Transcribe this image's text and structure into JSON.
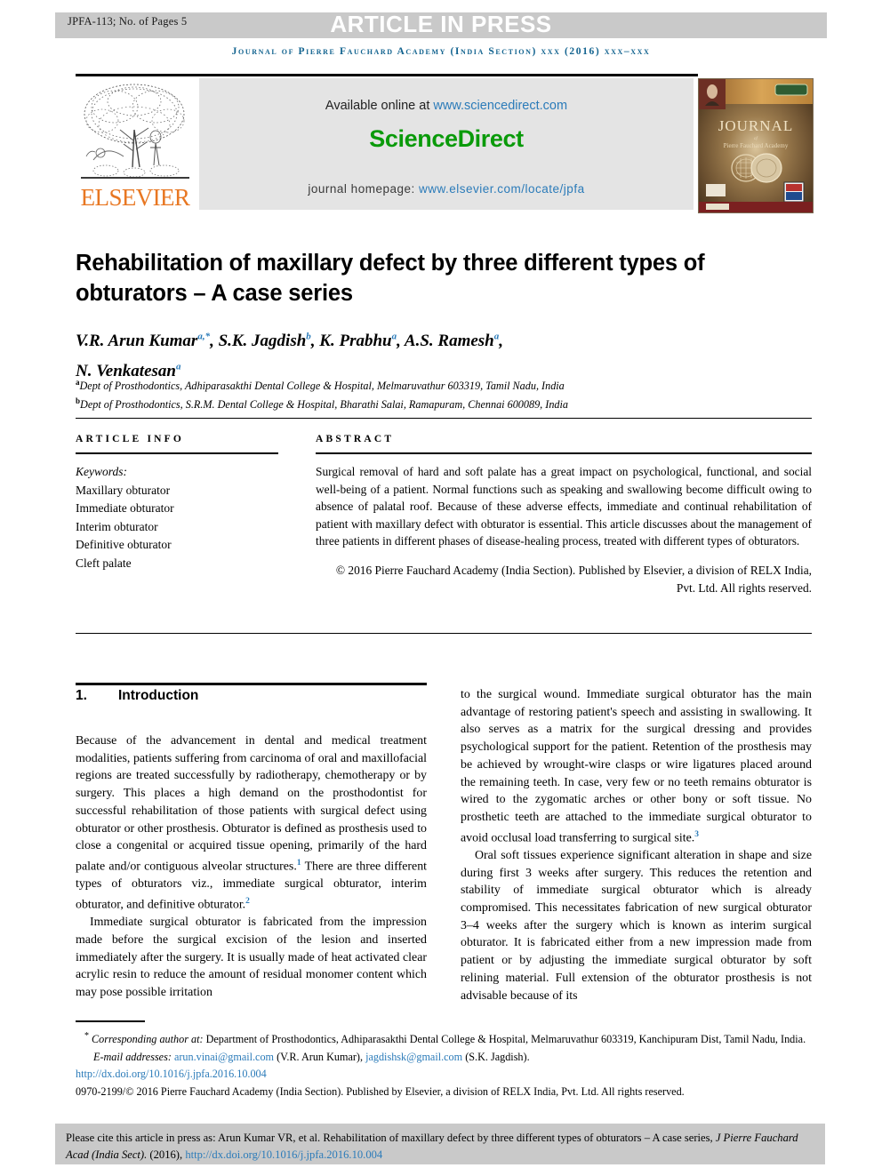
{
  "header": {
    "jpfa_label": "JPFA-113; No. of Pages 5",
    "article_in_press": "ARTICLE IN PRESS",
    "journal_line": "Journal of Pierre Fauchard Academy (India Section) xxx (2016) xxx–xxx"
  },
  "masthead": {
    "elsevier_wordmark": "ELSEVIER",
    "available_online_prefix": "Available online at ",
    "sciencedirect_url": "www.sciencedirect.com",
    "sciencedirect_logo": "ScienceDirect",
    "homepage_prefix": "journal homepage: ",
    "homepage_url": "www.elsevier.com/locate/jpfa",
    "cover_title": "JOURNAL",
    "cover_subtitle": "Pierre Fauchard Academy"
  },
  "article": {
    "title": "Rehabilitation of maxillary defect by three different types of obturators – A case series",
    "affiliation_a": "Dept of Prosthodontics, Adhiparasakthi Dental College & Hospital, Melmaruvathur 603319, Tamil Nadu, India",
    "affiliation_b": "Dept of Prosthodontics, S.R.M. Dental College & Hospital, Bharathi Salai, Ramapuram, Chennai 600089, India",
    "authors": [
      {
        "name": "V.R. Arun Kumar",
        "marks": "a,*"
      },
      {
        "name": "S.K. Jagdish",
        "marks": "b"
      },
      {
        "name": "K. Prabhu",
        "marks": "a"
      },
      {
        "name": "A.S. Ramesh",
        "marks": "a"
      },
      {
        "name": "N. Venkatesan",
        "marks": "a"
      }
    ]
  },
  "article_info": {
    "heading": "ARTICLE INFO",
    "keywords_label": "Keywords:",
    "keywords": [
      "Maxillary obturator",
      "Immediate obturator",
      "Interim obturator",
      "Definitive obturator",
      "Cleft palate"
    ]
  },
  "abstract": {
    "heading": "ABSTRACT",
    "text": "Surgical removal of hard and soft palate has a great impact on psychological, functional, and social well-being of a patient. Normal functions such as speaking and swallowing become difficult owing to absence of palatal roof. Because of these adverse effects, immediate and continual rehabilitation of patient with maxillary defect with obturator is essential. This article discusses about the management of three patients in different phases of disease-healing process, treated with different types of obturators.",
    "copyright": "© 2016 Pierre Fauchard Academy (India Section). Published by Elsevier, a division of RELX India, Pvt. Ltd. All rights reserved."
  },
  "body": {
    "section_number": "1.",
    "section_title": "Introduction",
    "left_paragraphs": [
      {
        "indent": false,
        "parts": [
          {
            "t": "Because of the advancement in dental and medical treatment modalities, patients suffering from carcinoma of oral and maxillofacial regions are treated successfully by radiotherapy, chemotherapy or by surgery. This places a high demand on the prosthodontist for successful rehabilitation of those patients with surgical defect using obturator or other prosthesis. Obturator is defined as prosthesis used to close a congenital or acquired tissue opening, primarily of the hard palate and/or contiguous alveolar structures."
          },
          {
            "ref": "1"
          },
          {
            "t": " There are three different types of obturators viz., immediate surgical obturator, interim obturator, and definitive obturator."
          },
          {
            "ref": "2"
          }
        ]
      },
      {
        "indent": true,
        "parts": [
          {
            "t": "Immediate surgical obturator is fabricated from the impression made before the surgical excision of the lesion and inserted immediately after the surgery. It is usually made of heat activated clear acrylic resin to reduce the amount of residual monomer content which may pose possible irritation"
          }
        ]
      }
    ],
    "right_paragraphs": [
      {
        "indent": false,
        "parts": [
          {
            "t": "to the surgical wound. Immediate surgical obturator has the main advantage of restoring patient's speech and assisting in swallowing. It also serves as a matrix for the surgical dressing and provides psychological support for the patient. Retention of the prosthesis may be achieved by wrought-wire clasps or wire ligatures placed around the remaining teeth. In case, very few or no teeth remains obturator is wired to the zygomatic arches or other bony or soft tissue. No prosthetic teeth are attached to the immediate surgical obturator to avoid occlusal load transferring to surgical site."
          },
          {
            "ref": "3"
          }
        ]
      },
      {
        "indent": true,
        "parts": [
          {
            "t": "Oral soft tissues experience significant alteration in shape and size during first 3 weeks after surgery. This reduces the retention and stability of immediate surgical obturator which is already compromised. This necessitates fabrication of new surgical obturator 3–4 weeks after the surgery which is known as interim surgical obturator. It is fabricated either from a new impression made from patient or by adjusting the immediate surgical obturator by soft relining material. Full extension of the obturator prosthesis is not advisable because of its"
          }
        ]
      }
    ]
  },
  "footnotes": {
    "corresponding_marker": "*",
    "corresponding_label": "Corresponding author at:",
    "corresponding_text": " Department of Prosthodontics, Adhiparasakthi Dental College & Hospital, Melmaruvathur 603319, Kanchipuram Dist, Tamil Nadu, India.",
    "email_label": "E-mail addresses:",
    "email_1": "arun.vinai@gmail.com",
    "email_1_owner": "(V.R. Arun Kumar)",
    "email_2": "jagdishsk@gmail.com",
    "email_2_owner": "(S.K. Jagdish).",
    "doi_url": "http://dx.doi.org/10.1016/j.jpfa.2016.10.004",
    "issn_line": "0970-2199/© 2016 Pierre Fauchard Academy (India Section). Published by Elsevier, a division of RELX India, Pvt. Ltd. All rights reserved."
  },
  "cite_box": {
    "prefix": "Please cite this article in press as: Arun Kumar VR, et al. Rehabilitation of maxillary defect by three different types of obturators – A case series, ",
    "journal_italic": "J Pierre Fauchard Acad (India Sect).",
    "year": " (2016), ",
    "doi_url": "http://dx.doi.org/10.1016/j.jpfa.2016.10.004"
  },
  "colors": {
    "link_blue": "#2b7bb9",
    "journal_blue": "#12638f",
    "elsevier_orange": "#e87722",
    "sciencedirect_green": "#0a9a0a",
    "band_gray": "#c9c9c9",
    "banner_gray": "#e4e4e4"
  }
}
